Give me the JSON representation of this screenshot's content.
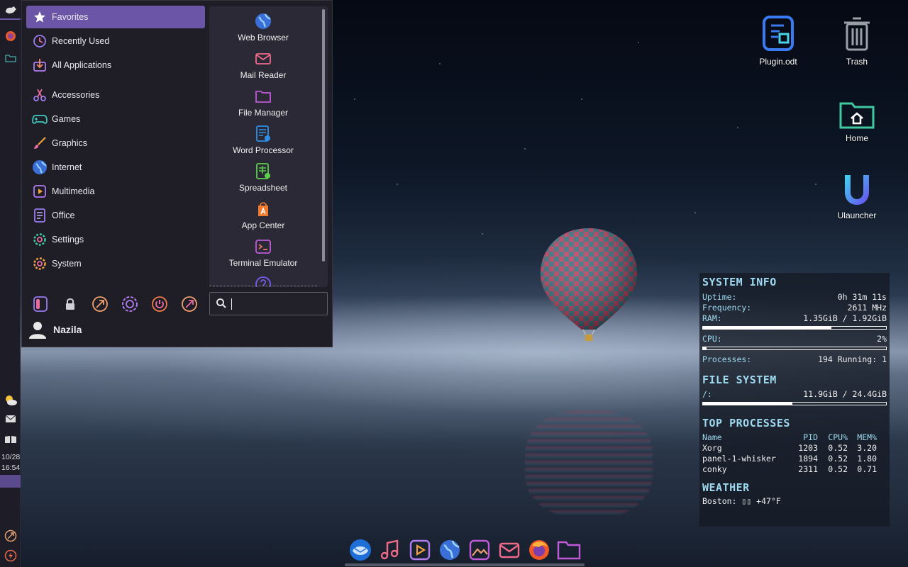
{
  "menu": {
    "categories": [
      {
        "label": "Favorites",
        "icon": "star-icon"
      },
      {
        "label": "Recently Used",
        "icon": "clock-icon"
      },
      {
        "label": "All Applications",
        "icon": "download-box-icon"
      },
      {
        "label": "Accessories",
        "icon": "scissors-icon"
      },
      {
        "label": "Games",
        "icon": "gamepad-icon"
      },
      {
        "label": "Graphics",
        "icon": "brush-icon"
      },
      {
        "label": "Internet",
        "icon": "globe-icon"
      },
      {
        "label": "Multimedia",
        "icon": "play-icon"
      },
      {
        "label": "Office",
        "icon": "document-icon"
      },
      {
        "label": "Settings",
        "icon": "gear-icon"
      },
      {
        "label": "System",
        "icon": "gear-icon"
      }
    ],
    "apps": [
      {
        "label": "Web Browser",
        "icon": "globe-icon"
      },
      {
        "label": "Mail Reader",
        "icon": "mail-icon"
      },
      {
        "label": "File Manager",
        "icon": "folder-icon"
      },
      {
        "label": "Word Processor",
        "icon": "word-doc-icon"
      },
      {
        "label": "Spreadsheet",
        "icon": "spreadsheet-icon"
      },
      {
        "label": "App Center",
        "icon": "app-center-icon"
      },
      {
        "label": "Terminal Emulator",
        "icon": "terminal-icon"
      }
    ],
    "user": "Nazila",
    "search_value": ""
  },
  "desktop": {
    "icons": [
      {
        "label": "Plugin.odt"
      },
      {
        "label": "Trash"
      },
      {
        "label": "Home"
      },
      {
        "label": "Ulauncher"
      }
    ]
  },
  "panel": {
    "date": "10/28",
    "time": "16:54"
  },
  "conky": {
    "system_info_title": "SYSTEM INFO",
    "uptime_label": "Uptime:",
    "uptime": "0h 31m 11s",
    "frequency_label": "Frequency:",
    "frequency": "2611 MHz",
    "ram_label": "RAM:",
    "ram": "1.35GiB / 1.92GiB",
    "ram_fraction": 0.7,
    "cpu_label": "CPU:",
    "cpu": "2%",
    "cpu_fraction": 0.02,
    "processes_label": "Processes:",
    "processes": "194 Running: 1",
    "fs_title": "FILE SYSTEM",
    "fs_label": "/:",
    "fs": "11.9GiB / 24.4GiB",
    "fs_fraction": 0.49,
    "top_title": "TOP PROCESSES",
    "top_headers": [
      "Name",
      "PID",
      "CPU%",
      "MEM%"
    ],
    "top_rows": [
      [
        "Xorg",
        "1203",
        "0.52",
        "3.20"
      ],
      [
        "panel-1-whisker",
        "1894",
        "0.52",
        "1.80"
      ],
      [
        "conky",
        "2311",
        "0.52",
        "0.71"
      ]
    ],
    "weather_title": "WEATHER",
    "weather": "Boston: ▯▯  +47°F"
  },
  "dock": {
    "items": [
      "thunderbird-icon",
      "music-icon",
      "video-player-icon",
      "globe-icon",
      "image-viewer-icon",
      "mail-icon",
      "firefox-icon",
      "folder-icon"
    ]
  }
}
